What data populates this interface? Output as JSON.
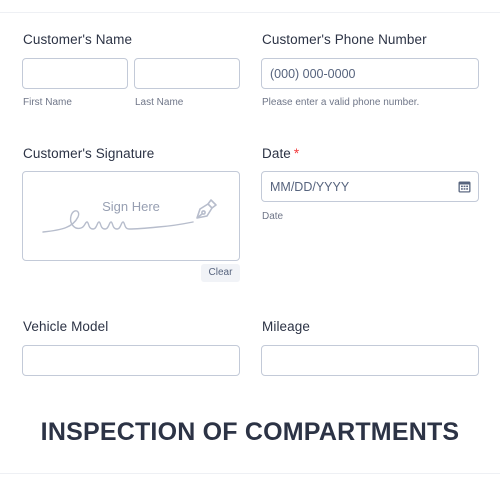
{
  "customer_name": {
    "label": "Customer's Name",
    "first": {
      "value": "",
      "sublabel": "First Name"
    },
    "last": {
      "value": "",
      "sublabel": "Last Name"
    }
  },
  "phone": {
    "label": "Customer's Phone Number",
    "placeholder": "(000) 000-0000",
    "sublabel": "Please enter a valid phone number."
  },
  "signature": {
    "label": "Customer's Signature",
    "placeholder": "Sign Here",
    "clear_label": "Clear",
    "icon": "pen-nib-icon"
  },
  "date": {
    "label": "Date",
    "required_mark": "*",
    "placeholder": "MM/DD/YYYY",
    "sublabel": "Date",
    "icon": "calendar-icon"
  },
  "vehicle_model": {
    "label": "Vehicle Model",
    "value": ""
  },
  "mileage": {
    "label": "Mileage",
    "value": ""
  },
  "section": {
    "title": "INSPECTION OF COMPARTMENTS"
  },
  "colors": {
    "text": "#2c3345",
    "border": "#c3cad8",
    "required": "#f23a3c",
    "muted": "#6f7688"
  }
}
